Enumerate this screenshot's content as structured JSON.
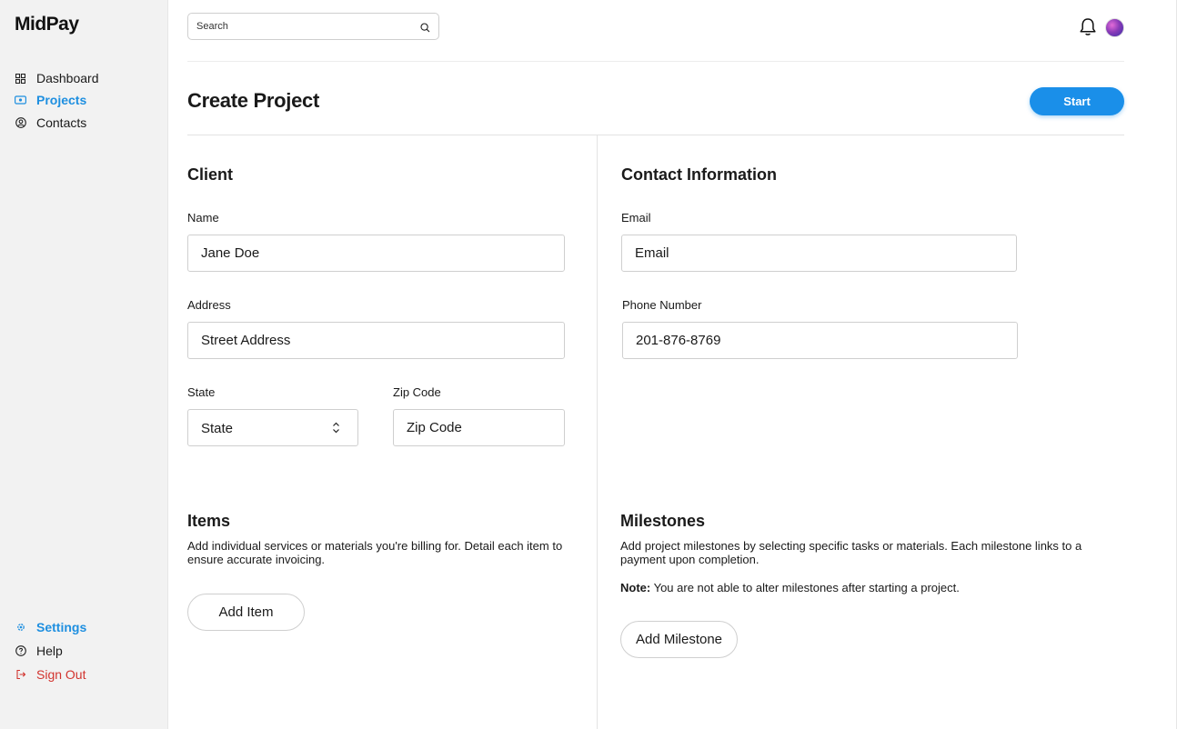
{
  "app": {
    "logo_text": "MidPay"
  },
  "sidebar": {
    "items": [
      {
        "label": "Dashboard",
        "icon": "grid-icon"
      },
      {
        "label": "Projects",
        "icon": "ticket-icon",
        "active": true
      },
      {
        "label": "Contacts",
        "icon": "user-circle-icon"
      }
    ],
    "bottom_items": [
      {
        "label": "Settings",
        "icon": "gear-icon",
        "active": true
      },
      {
        "label": "Help",
        "icon": "question-circle-icon"
      },
      {
        "label": "Sign Out",
        "icon": "sign-out-icon",
        "danger": true
      }
    ]
  },
  "header": {
    "search_placeholder": "Search",
    "icons": [
      "bell-icon",
      "avatar"
    ]
  },
  "page": {
    "title": "Create Project",
    "start_label": "Start"
  },
  "client": {
    "title": "Client",
    "name_label": "Name",
    "name_value": "Jane Doe",
    "address_label": "Address",
    "address_placeholder": "Street Address",
    "state_label": "State",
    "state_value": "State",
    "zip_label": "Zip Code",
    "zip_placeholder": "Zip Code"
  },
  "contact": {
    "title": "Contact Information",
    "email_label": "Email",
    "email_placeholder": "Email",
    "phone_label": "Phone Number",
    "phone_value": "201-876-8769"
  },
  "items": {
    "title": "Items",
    "description": "Add individual services or materials you're billing for. Detail each item to ensure accurate invoicing.",
    "add_label": "Add Item"
  },
  "milestones": {
    "title": "Milestones",
    "description": "Add project milestones by selecting specific tasks or materials. Each milestone links to a payment upon completion.",
    "note_label": "Note:",
    "note_text": " You are not able to alter milestones after starting a project.",
    "add_label": "Add Milestone"
  },
  "colors": {
    "accent": "#1a8fe9",
    "active_nav": "#1e8fe0",
    "danger": "#d2342f",
    "sidebar_bg": "#f2f2f2"
  }
}
